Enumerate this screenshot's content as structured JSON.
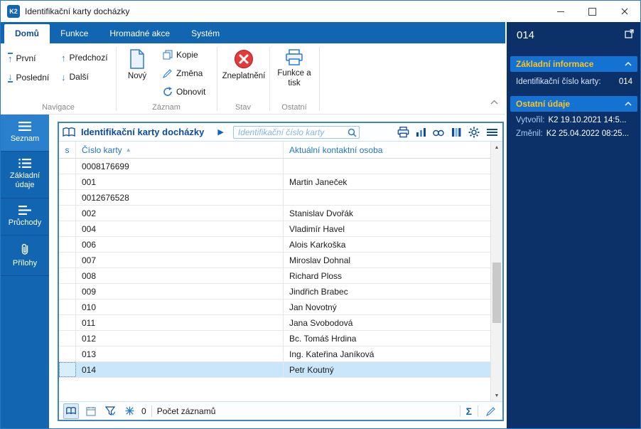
{
  "window": {
    "title": "Identifikační karty docházky",
    "app_icon_text": "K2"
  },
  "tabs": [
    {
      "label": "Domů"
    },
    {
      "label": "Funkce"
    },
    {
      "label": "Hromadné akce"
    },
    {
      "label": "Systém"
    }
  ],
  "ribbon": {
    "navigace": {
      "caption": "Navigace",
      "first": "První",
      "last": "Poslední",
      "prev": "Předchozí",
      "next": "Další"
    },
    "zaznam": {
      "caption": "Záznam",
      "new": "Nový",
      "copy": "Kopie",
      "change": "Změna",
      "refresh": "Obnovit"
    },
    "stav": {
      "caption": "Stav",
      "invalidate": "Zneplatnění"
    },
    "ostatni": {
      "caption": "Ostatní",
      "print": "Funkce a tisk"
    }
  },
  "sidebar": {
    "items": [
      {
        "label": "Seznam"
      },
      {
        "label": "Základní údaje"
      },
      {
        "label": "Průchody"
      },
      {
        "label": "Přílohy"
      }
    ]
  },
  "browse": {
    "title": "Identifikační karty docházky",
    "search_placeholder": "Identifikační číslo karty",
    "columns": {
      "status": "s",
      "card": "Číslo karty",
      "person": "Aktuální kontaktní osoba"
    },
    "rows": [
      {
        "card": "0008176699",
        "person": ""
      },
      {
        "card": "001",
        "person": "Martin Janeček"
      },
      {
        "card": "0012676528",
        "person": ""
      },
      {
        "card": "002",
        "person": "Stanislav Dvořák"
      },
      {
        "card": "004",
        "person": "Vladimír Havel"
      },
      {
        "card": "006",
        "person": "Alois Karkoška"
      },
      {
        "card": "007",
        "person": "Miroslav Dohnal"
      },
      {
        "card": "008",
        "person": "Richard Ploss"
      },
      {
        "card": "009",
        "person": "Jindřich Brabec"
      },
      {
        "card": "010",
        "person": "Jan Novotný"
      },
      {
        "card": "011",
        "person": "Jana Svobodová"
      },
      {
        "card": "012",
        "person": "Bc. Tomáš Hrdina"
      },
      {
        "card": "013",
        "person": "Ing. Kateřina Janíková"
      },
      {
        "card": "014",
        "person": "Petr Koutný"
      }
    ],
    "status": {
      "count": "0",
      "count_label": "Počet záznamů"
    }
  },
  "panel": {
    "title": "014",
    "basic": {
      "title": "Základní informace",
      "field_label": "Identifikační číslo karty:",
      "field_value": "014"
    },
    "other": {
      "title": "Ostatní údaje",
      "created_label": "Vytvořil:",
      "created_value": "K2 19.10.2021 14:5...",
      "changed_label": "Změnil:",
      "changed_value": "K2 25.04.2022 08:25..."
    }
  },
  "icons": {
    "sort_asc": "▲",
    "play": "▶",
    "sigma": "Σ",
    "up": "↑",
    "down": "↓",
    "scroll_up": "▲",
    "scroll_down": "▼"
  }
}
